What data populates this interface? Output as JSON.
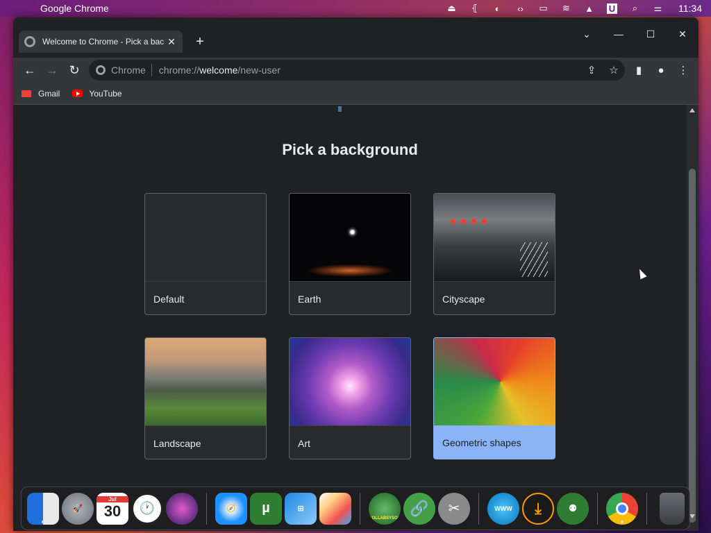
{
  "menubar": {
    "app_name": "Google Chrome",
    "clock": "11:34",
    "u_icon_label": "U"
  },
  "tab": {
    "title": "Welcome to Chrome - Pick a bac",
    "close": "✕"
  },
  "newtab": "+",
  "window_controls": {
    "dropdown": "⌄",
    "minimize": "—",
    "maximize": "☐",
    "close": "✕"
  },
  "toolbar": {
    "back": "←",
    "forward": "→",
    "reload": "↻",
    "site_chip": "Chrome",
    "url_prefix": "chrome://",
    "url_host": "welcome",
    "url_path": "/new-user",
    "share": "⇪",
    "star": "☆",
    "sidepanel": "▮",
    "profile": "●",
    "menu": "⋮"
  },
  "bookmarks": [
    {
      "label": "Gmail"
    },
    {
      "label": "YouTube"
    }
  ],
  "page": {
    "heading": "Pick a background",
    "backgrounds": [
      {
        "label": "Default"
      },
      {
        "label": "Earth"
      },
      {
        "label": "Cityscape"
      },
      {
        "label": "Landscape"
      },
      {
        "label": "Art"
      },
      {
        "label": "Geometric shapes",
        "selected": true
      }
    ]
  },
  "dock": {
    "calendar_month": "Jul",
    "calendar_day": "30",
    "collabsysos_label": "COLLABSYSOS",
    "www_label": "WWW"
  },
  "colors": {
    "accent_blue": "#8ab4f8",
    "window_bg": "#202124",
    "toolbar_bg": "#35363a"
  }
}
